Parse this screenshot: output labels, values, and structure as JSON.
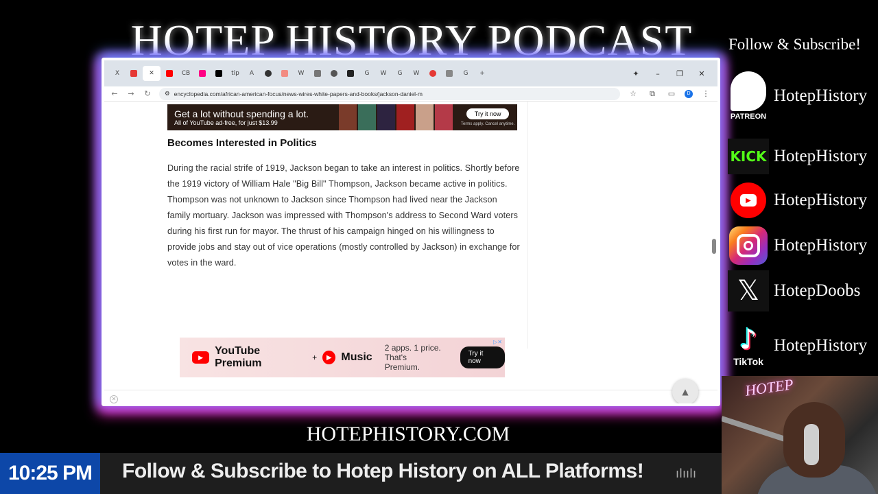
{
  "overlay": {
    "title": "HOTEP HISTORY PODCAST",
    "follow_heading": "Follow & Subscribe!",
    "website": "HOTEPHISTORY.COM",
    "clock": "10:25 PM",
    "ticker": "Follow & Subscribe to Hotep History on ALL Platforms!",
    "webcam_sign": "HOTEP"
  },
  "socials": [
    {
      "platform": "Patreon",
      "icon": "patreon-icon",
      "caption": "PATREON",
      "handle": "HotepHistory"
    },
    {
      "platform": "Kick",
      "icon": "kick-icon",
      "logo_text": "KICK",
      "handle": "HotepHistory"
    },
    {
      "platform": "YouTube",
      "icon": "youtube-icon",
      "handle": "HotepHistory"
    },
    {
      "platform": "Instagram",
      "icon": "instagram-icon",
      "handle": "HotepHistory"
    },
    {
      "platform": "X",
      "icon": "x-icon",
      "handle": "HotepDoobs"
    },
    {
      "platform": "TikTok",
      "icon": "tiktok-icon",
      "caption": "TikTok",
      "handle": "HotepHistory"
    }
  ],
  "browser": {
    "url": "encyclopedia.com/african-american-focus/news-wires-white-papers-and-books/jackson-daniel-m",
    "profile_initial": "D",
    "tabs": [
      "X",
      "R",
      "",
      "Y",
      "CB",
      "",
      "",
      "tip",
      "A",
      "",
      "",
      "W",
      "",
      "",
      "",
      "G",
      "W",
      "G",
      "W",
      "",
      "",
      "G"
    ],
    "colors": {
      "accent": "#1a73e8",
      "tabbar": "#dde3ea"
    }
  },
  "article": {
    "ad_top": {
      "headline": "Get a lot without spending a lot.",
      "subline": "All of YouTube ad-free, for just $13.99",
      "cta": "Try it now",
      "fine_print": "Terms apply. Cancel anytime."
    },
    "heading": "Becomes Interested in Politics",
    "paragraph": "During the racial strife of 1919, Jackson began to take an interest in politics. Shortly before the 1919 victory of William Hale \"Big Bill\" Thompson, Jackson became active in politics. Thompson was not unknown to Jackson since Thompson had lived near the Jackson family mortuary. Jackson was impressed with Thompson's address to Second Ward voters during his first run for mayor. The thrust of his campaign hinged on his willingness to provide jobs and stay out of vice operations (mostly controlled by Jackson) in exchange for votes in the ward.",
    "ad_bottom": {
      "brand": "YouTube Premium",
      "plus": "+",
      "music": "Music",
      "slogan_line1": "2 apps. 1 price.",
      "slogan_line2": "That's Premium.",
      "cta": "Try it now"
    }
  }
}
